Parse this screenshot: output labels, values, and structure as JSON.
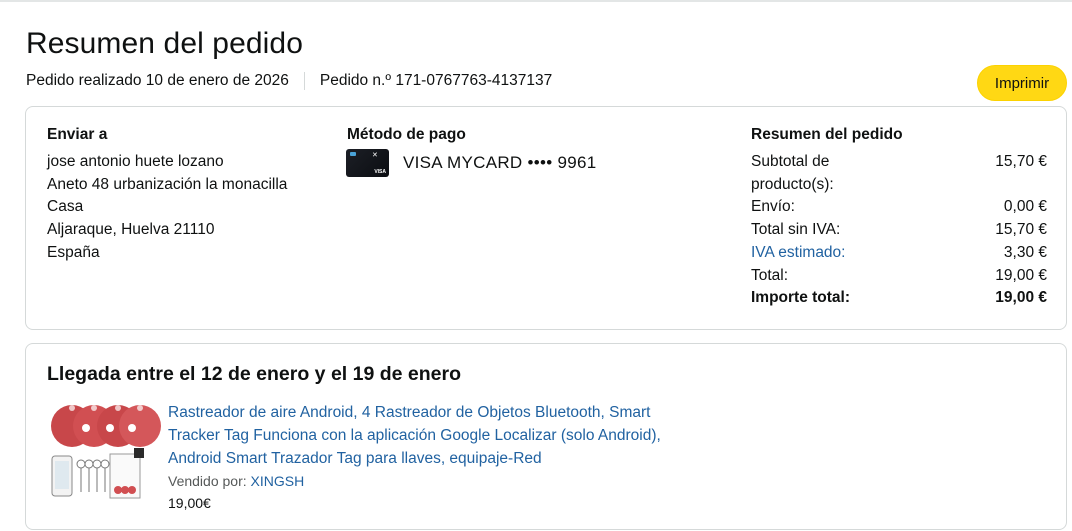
{
  "header": {
    "title": "Resumen del pedido",
    "order_date": "Pedido realizado 10 de enero de 2026",
    "order_number": "Pedido n.º 171-0767763-4137137",
    "print_label": "Imprimir"
  },
  "shipping": {
    "heading": "Enviar a",
    "lines": [
      "jose antonio huete lozano",
      "Aneto 48 urbanización la monacilla",
      "Casa",
      "Aljaraque, Huelva 21110",
      "España"
    ]
  },
  "payment": {
    "heading": "Método de pago",
    "method": "VISA MYCARD •••• 9961",
    "icon": "credit-card-icon"
  },
  "summary": {
    "heading": "Resumen del pedido",
    "rows": [
      {
        "label": "Subtotal de producto(s):",
        "value": "15,70 €"
      },
      {
        "label": "Envío:",
        "value": "0,00 €"
      },
      {
        "label": "Total sin IVA:",
        "value": "15,70 €"
      },
      {
        "label": "IVA estimado:",
        "value": "3,30 €"
      },
      {
        "label": "Total:",
        "value": "19,00 €"
      },
      {
        "label": "Importe total:",
        "value": "19,00 €"
      }
    ]
  },
  "shipment": {
    "arrival": "Llegada entre el 12 de enero y el 19 de enero",
    "product": {
      "title": "Rastreador de aire Android, 4 Rastreador de Objetos Bluetooth, Smart Tracker Tag Funciona con la aplicación Google Localizar (solo Android), Android Smart Trazador Tag para llaves, equipaje-Red",
      "sold_by_label": "Vendido por: ",
      "seller": "XINGSH",
      "price": "19,00€"
    }
  },
  "colors": {
    "link": "#2162a1",
    "button": "#ffd814",
    "border": "#d5d9d9"
  }
}
